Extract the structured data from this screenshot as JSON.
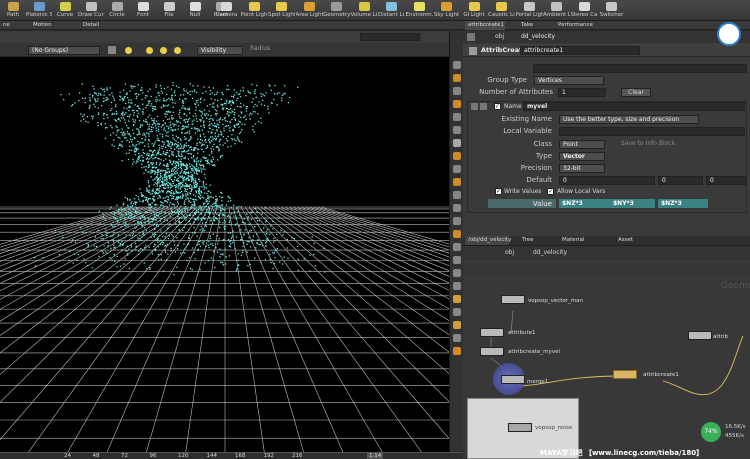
{
  "toolbar": {
    "items": [
      "Path",
      "Platonic S...",
      "Curve",
      "Draw Curve",
      "Circle",
      "Font",
      "File",
      "Null",
      "Rivet",
      "Camera",
      "Point Light",
      "Spot Light",
      "Area Light",
      "Geometry...",
      "Volume Li...",
      "Distant Li...",
      "Environm...",
      "Sky Light",
      "GI Light",
      "Caustic Li...",
      "Portal Light",
      "Ambient L...",
      "Stereo Ca...",
      "Switcher"
    ]
  },
  "left_tabs": [
    "ne View",
    "Motion View",
    "Detail View"
  ],
  "right_tabs": [
    "attribcreate1",
    "Take List",
    "Performance Monitor"
  ],
  "viewport": {
    "group_select": "(No Groups)",
    "visibility": "Visibility",
    "radius": "Radius"
  },
  "param": {
    "path_obj": "obj",
    "path_node": "dd_velocity",
    "node_type": "AttribCreate",
    "node_name": "attribcreate1",
    "group_label": "Group",
    "group_type_label": "Group Type",
    "group_type": "Vertices",
    "num_attr_label": "Number of Attributes",
    "num_attr": "1",
    "clear": "Clear",
    "name_label": "Name",
    "name": "myvel",
    "existing_label": "Existing Name",
    "existing": "Use the better type, size and precision",
    "local_var_label": "Local Variable",
    "class_label": "Class",
    "class": "Point",
    "save_info": "Save to Info Block",
    "type_label": "Type",
    "type": "Vector",
    "precision_label": "Precision",
    "precision": "32-bit",
    "default_label": "Default",
    "defaults": [
      "0",
      "0",
      "0"
    ],
    "write_values": "Write Values",
    "allow_local": "Allow Local Vars",
    "value_label": "Value",
    "values": [
      "$NZ*3",
      "$NY*3",
      "$NZ*3"
    ]
  },
  "net_tabs": [
    "/obj/dd_velocity",
    "Tree View",
    "Material Palette",
    "Asset Browser"
  ],
  "net": {
    "path_obj": "obj",
    "path_node": "dd_velocity",
    "watermark": "Geome",
    "nodes": [
      "vopsop_vector_man",
      "attribute1",
      "attribcreate_myvel",
      "merge1",
      "attribcreate1",
      "vopsop_noise",
      "attrib"
    ]
  },
  "status": {
    "percent": "74%",
    "up": "16.5K/s",
    "down": "455K/s"
  },
  "ruler": {
    "ticks": [
      "24",
      "48",
      "72",
      "96",
      "120",
      "144",
      "168",
      "192",
      "216"
    ],
    "current": "1.14"
  },
  "watermark_text": "MAYA学习吧 【www.linecg.com/tieba/180】"
}
